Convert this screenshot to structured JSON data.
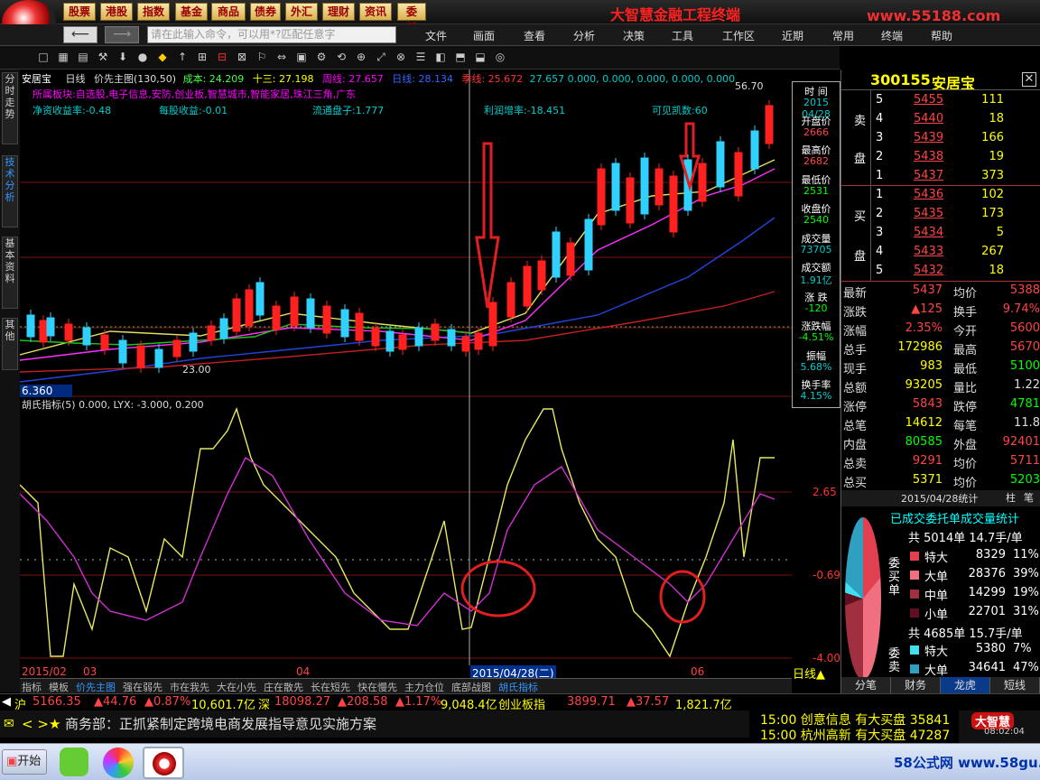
{
  "top_menu": [
    "股票",
    "港股",
    "指数",
    "基金",
    "商品",
    "债券",
    "外汇",
    "理财",
    "资讯",
    "委托"
  ],
  "app_title": "大智慧金融工程终端",
  "site_url": "www.55188.com",
  "command_placeholder": "请在此输入命令，可以用*?匹配任意字",
  "main_menu": [
    "文件",
    "画面",
    "查看",
    "分析",
    "决策",
    "工具",
    "工作区",
    "近期",
    "常用",
    "终端",
    "帮助"
  ],
  "left_tabs": [
    "分时走势",
    "技术分析",
    "基本资料",
    "其他"
  ],
  "chart_header": {
    "name": "安居宝",
    "period": "日线",
    "indicator": "价先主图(130,50)",
    "cost_label": "成本:",
    "cost_value": "24.209",
    "thirteen_label": "十三:",
    "thirteen_value": "27.198",
    "week_label": "周线:",
    "week_value": "27.657",
    "day_label": "日线:",
    "day_value": "28.134",
    "season_label": "季线:",
    "season_value": "25.672",
    "extra": "27.657  0.000, 0.000, 0.000, 0.000, 0.000"
  },
  "info_line1": "所属板块:自选股,电子信息,安防,创业板,智慧城市,智能家居,珠江三角,广东",
  "info_line2": {
    "roe": "净资收益率:-0.48",
    "eps": "每股收益:-0.01",
    "float": "流通盘子:1.777",
    "profit": "利润增率:-18.451",
    "kaimen": "可见凯数:60"
  },
  "price_axis": [
    "5670",
    "56.70",
    "6.360"
  ],
  "low_label": "23.00",
  "sub_header": "胡氏指标(5) 0.000, LYX: -3.000, 0.200",
  "sub_axis": [
    "2.65",
    "-0.69",
    "-4.00"
  ],
  "date_axis": [
    "2015/02",
    "03",
    "04",
    "2015/04/28(二)",
    "06"
  ],
  "period_label": "日线",
  "side_panel": [
    {
      "label": "时 间",
      "value": "2015 04/28"
    },
    {
      "label": "开盘价",
      "value": "2666"
    },
    {
      "label": "最高价",
      "value": "2682"
    },
    {
      "label": "最低价",
      "value": "2531"
    },
    {
      "label": "收盘价",
      "value": "2540"
    },
    {
      "label": "成交量",
      "value": "73705"
    },
    {
      "label": "成交额",
      "value": "1.91亿"
    },
    {
      "label": "涨 跌",
      "value": "-120"
    },
    {
      "label": "涨跌幅",
      "value": "-4.51%"
    },
    {
      "label": "振幅",
      "value": "5.68%"
    },
    {
      "label": "换手率",
      "value": "4.15%"
    }
  ],
  "quote": {
    "code": "300155",
    "name": "安居宝",
    "sell_label": [
      "卖",
      "盘"
    ],
    "buy_label": [
      "买",
      "盘"
    ],
    "sell": [
      {
        "n": "5",
        "p": "5455",
        "v": "111"
      },
      {
        "n": "4",
        "p": "5440",
        "v": "18"
      },
      {
        "n": "3",
        "p": "5439",
        "v": "166"
      },
      {
        "n": "2",
        "p": "5438",
        "v": "19"
      },
      {
        "n": "1",
        "p": "5437",
        "v": "373"
      }
    ],
    "buy": [
      {
        "n": "1",
        "p": "5436",
        "v": "102"
      },
      {
        "n": "2",
        "p": "5435",
        "v": "173"
      },
      {
        "n": "3",
        "p": "5434",
        "v": "5"
      },
      {
        "n": "4",
        "p": "5433",
        "v": "267"
      },
      {
        "n": "5",
        "p": "5432",
        "v": "18"
      }
    ],
    "stats": [
      {
        "l": "最新",
        "v": "5437",
        "l2": "均价",
        "v2": "5388"
      },
      {
        "l": "涨跌",
        "v": "▲125",
        "l2": "换手",
        "v2": "9.74%"
      },
      {
        "l": "涨幅",
        "v": "2.35%",
        "l2": "今开",
        "v2": "5600"
      },
      {
        "l": "总手",
        "v": "172986",
        "l2": "最高",
        "v2": "5670"
      },
      {
        "l": "现手",
        "v": "983",
        "l2": "最低",
        "v2": "5100"
      },
      {
        "l": "总额",
        "v": "93205",
        "l2": "量比",
        "v2": "1.22"
      },
      {
        "l": "涨停",
        "v": "5843",
        "l2": "跌停",
        "v2": "4781"
      },
      {
        "l": "总笔",
        "v": "14612",
        "l2": "每笔",
        "v2": "11.8"
      },
      {
        "l": "内盘",
        "v": "80585",
        "l2": "外盘",
        "v2": "92401"
      },
      {
        "l": "总卖",
        "v": "9291",
        "l2": "均价",
        "v2": "5711"
      },
      {
        "l": "总买",
        "v": "5371",
        "l2": "均价",
        "v2": "5203"
      }
    ],
    "stat_date": "2015/04/28统计",
    "stat_tabs": [
      "柱",
      "笔"
    ],
    "stat_title": "已成交委托单成交量统计",
    "buy_title": "共 5014单 14.7手/单",
    "buy_side": "委买单",
    "buy_rows": [
      {
        "t": "特大",
        "v": "8329",
        "p": "11%",
        "c": "#e04050"
      },
      {
        "t": "大单",
        "v": "28376",
        "p": "39%",
        "c": "#f07080"
      },
      {
        "t": "中单",
        "v": "14299",
        "p": "19%",
        "c": "#a03040"
      },
      {
        "t": "小单",
        "v": "22701",
        "p": "31%",
        "c": "#601020"
      }
    ],
    "sell_title": "共 4685单 15.7手/单",
    "sell_side": "委卖",
    "sell_rows": [
      {
        "t": "特大",
        "v": "5380",
        "p": "7%",
        "c": "#40e0f0"
      },
      {
        "t": "大单",
        "v": "34641",
        "p": "47%",
        "c": "#30a0c0"
      }
    ],
    "bottom_tabs": [
      "分笔",
      "财务",
      "龙虎",
      "短线"
    ]
  },
  "bottom_tabs": [
    "指标",
    "模板",
    "价先主图",
    "强在弱先",
    "市在我先",
    "大在小先",
    "庄在散先",
    "长在短先",
    "快在慢先",
    "主力仓位",
    "底部战图",
    "胡氏指标"
  ],
  "ticker": {
    "sh_label": "沪",
    "sh": "5166.35",
    "sh_chg": "▲44.76",
    "sh_pct": "▲0.87%",
    "sh_amt": "10,601.7亿",
    "sz_label": "深",
    "sz": "18098.27",
    "sz_chg": "▲208.58",
    "sz_pct": "▲1.17%",
    "sz_amt": "9,048.4亿",
    "cy_label": "创业板指",
    "cy": "3899.71",
    "cy_chg": "▲37.57",
    "cy_amt": "1,821.7亿"
  },
  "news": "商务部：正抓紧制定跨境电商发展指导意见实施方案",
  "alerts": [
    {
      "t": "15:00 创意信息 有大买盘 35841"
    },
    {
      "t": "15:00 杭州高新 有大买盘 47287"
    }
  ],
  "taskbar": {
    "start": "开始",
    "clock": "08:02:04",
    "brand": "大智慧",
    "watermark": "58公式网 www.58gu.com"
  }
}
